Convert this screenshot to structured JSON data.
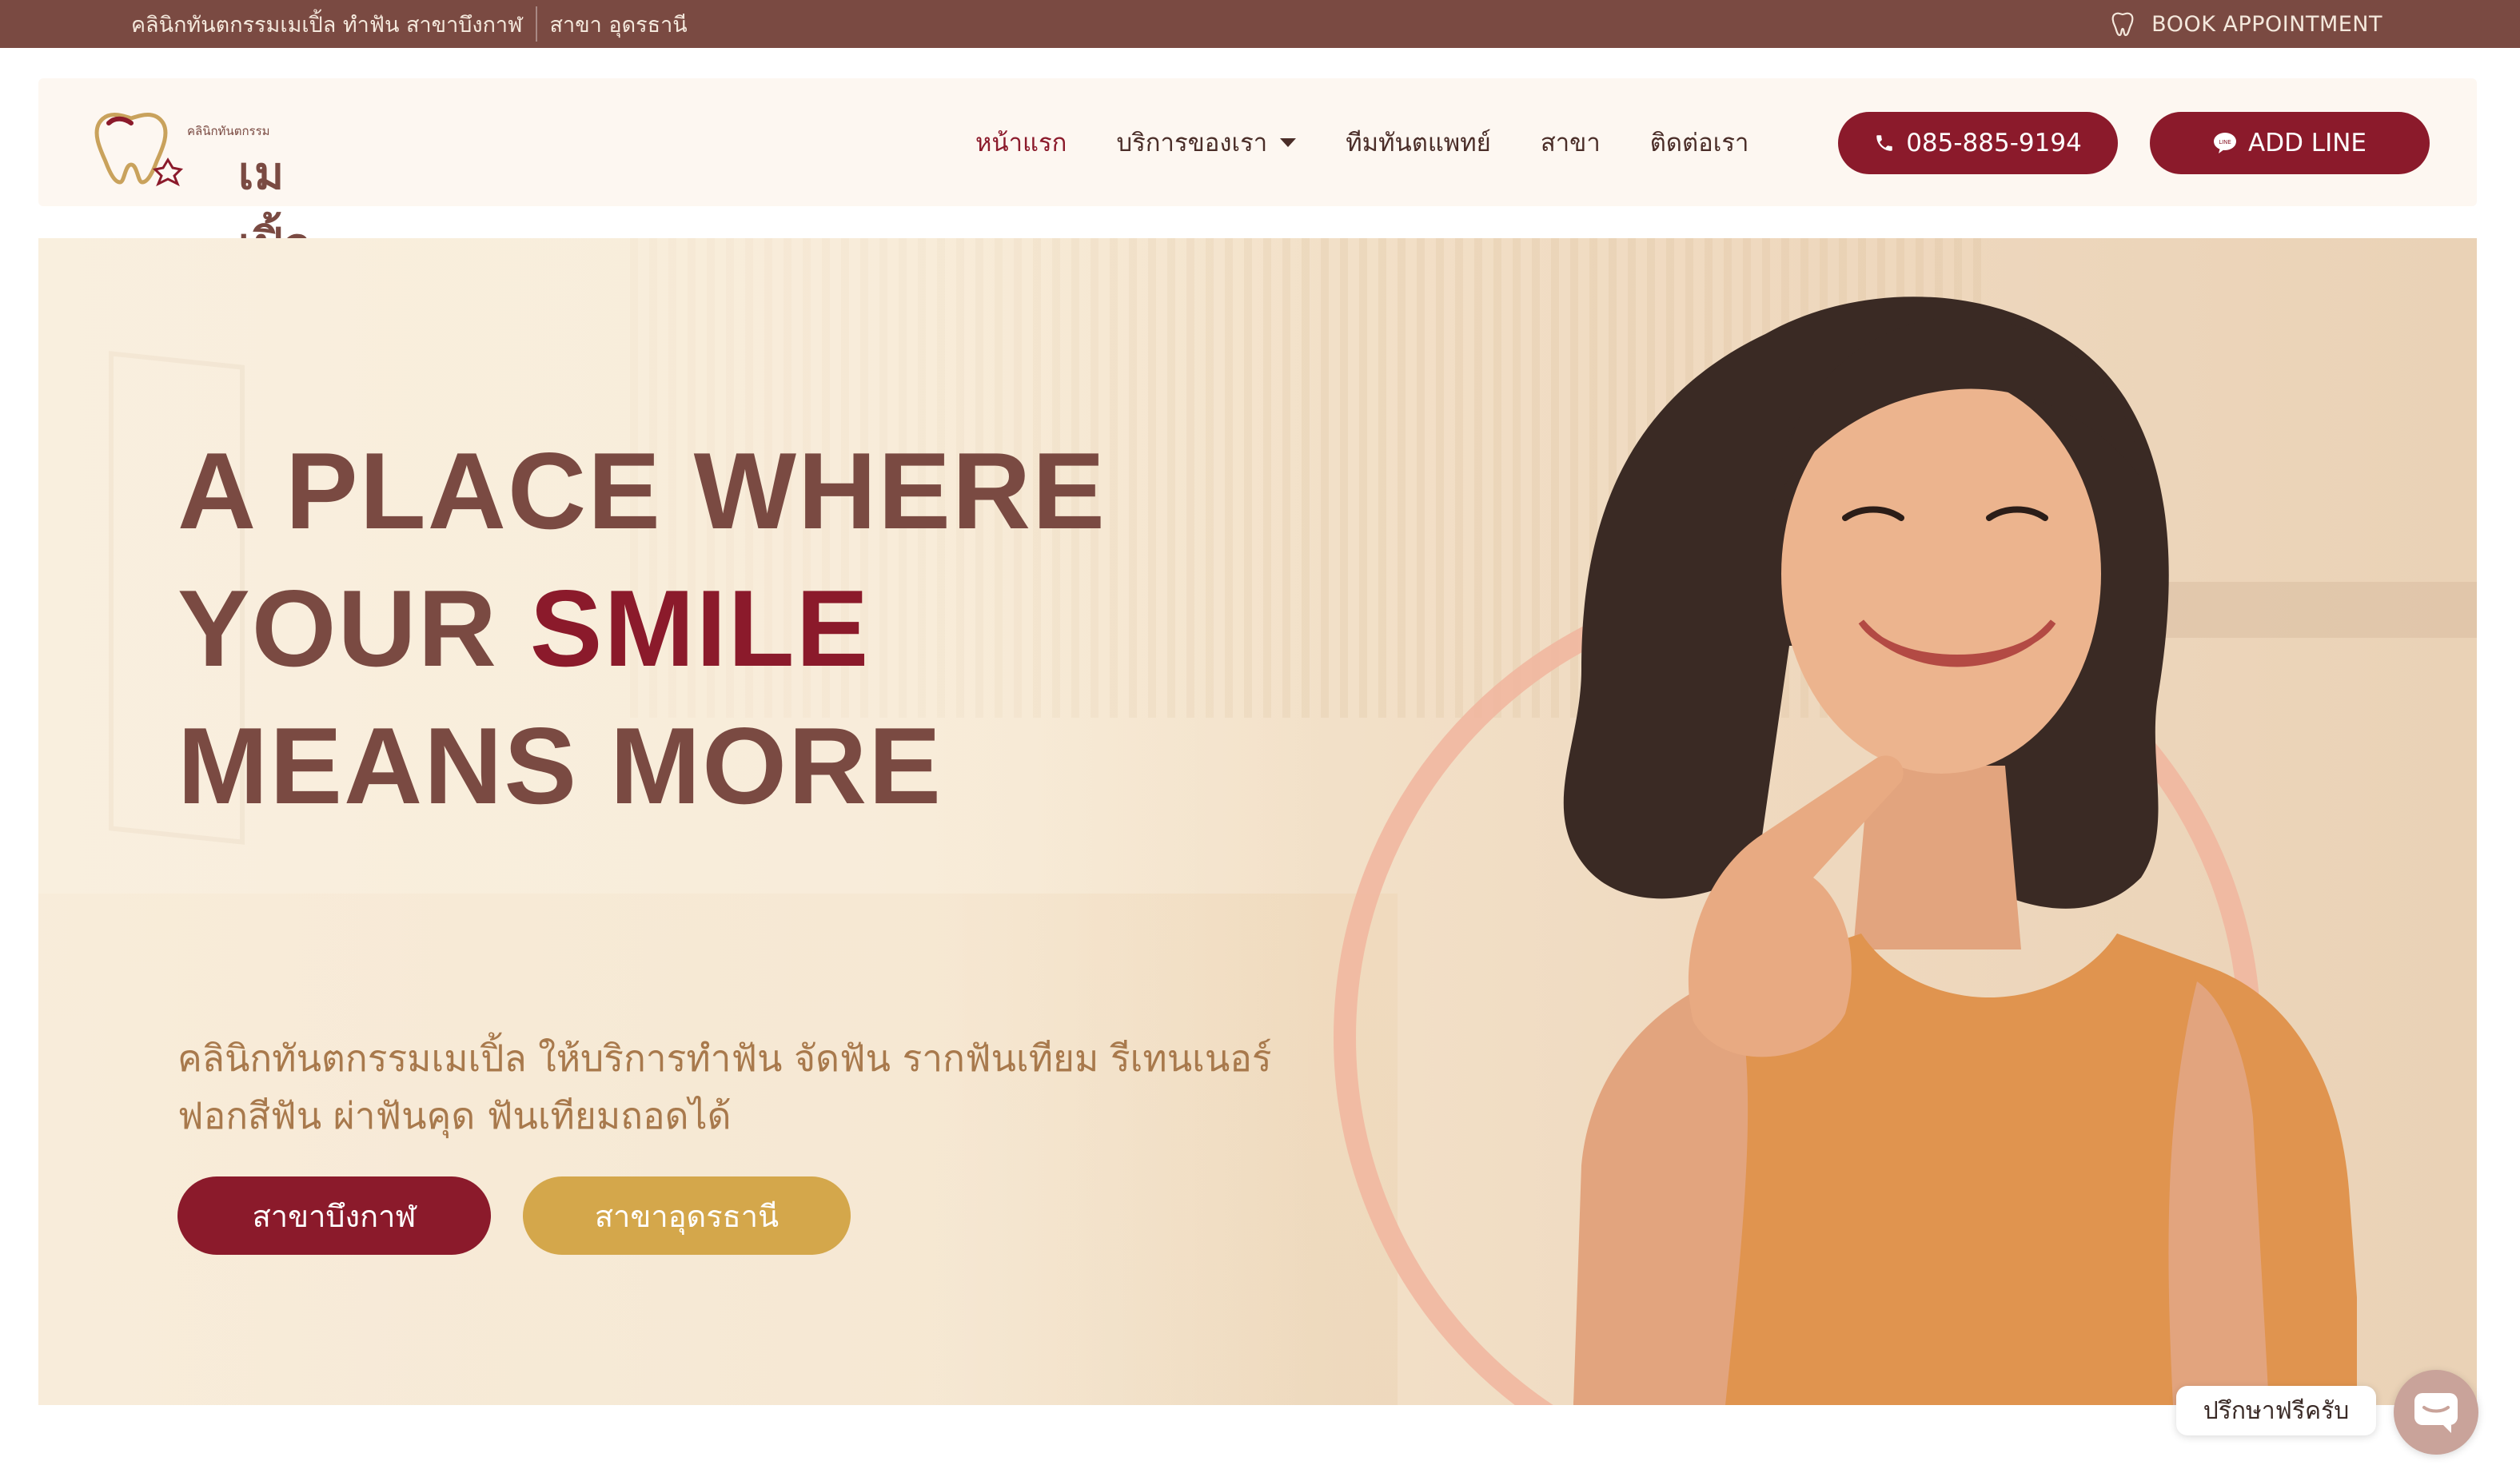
{
  "topbar": {
    "clinic_branch": "คลินิกทันตกรรมเมเปิ้ล ทำฟัน สาขาบึงกาฬ",
    "branch_udon": "สาขา อุดรธานี",
    "book_label": "BOOK APPOINTMENT",
    "book_icon": "tooth-icon"
  },
  "header": {
    "logo_tagline": "คลินิกทันตกรรม",
    "logo_name": "เมเปิ้ล",
    "nav": [
      {
        "label": "หน้าแรก",
        "active": true
      },
      {
        "label": "บริการของเรา",
        "has_dropdown": true
      },
      {
        "label": "ทีมทันตแพทย์"
      },
      {
        "label": "สาขา"
      },
      {
        "label": "ติดต่อเรา"
      }
    ],
    "phone_label": "085-885-9194",
    "line_label": "ADD LINE"
  },
  "hero": {
    "headline_line1": "A PLACE WHERE",
    "headline_line2_a": "YOUR ",
    "headline_line2_b": "SMILE",
    "headline_line3": "MEANS MORE",
    "subtext": "คลินิกทันตกรรมเมเปิ้ล ให้บริการทำฟัน จัดฟัน รากฟันเทียม รีเทนเนอร์ ฟอกสีฟัน ผ่าฟันคุด ฟันเทียมถอดได้",
    "button_bueng_kan": "สาขาบึงกาฬ",
    "button_udon": "สาขาอุดรธานี"
  },
  "chat": {
    "label": "ปรึกษาฟรีครับ",
    "icon": "chat-icon"
  },
  "colors": {
    "brand_maroon": "#8b1a2b",
    "brand_brown": "#7a4a42",
    "gold": "#d4a74b",
    "subtext": "#a8794c"
  }
}
